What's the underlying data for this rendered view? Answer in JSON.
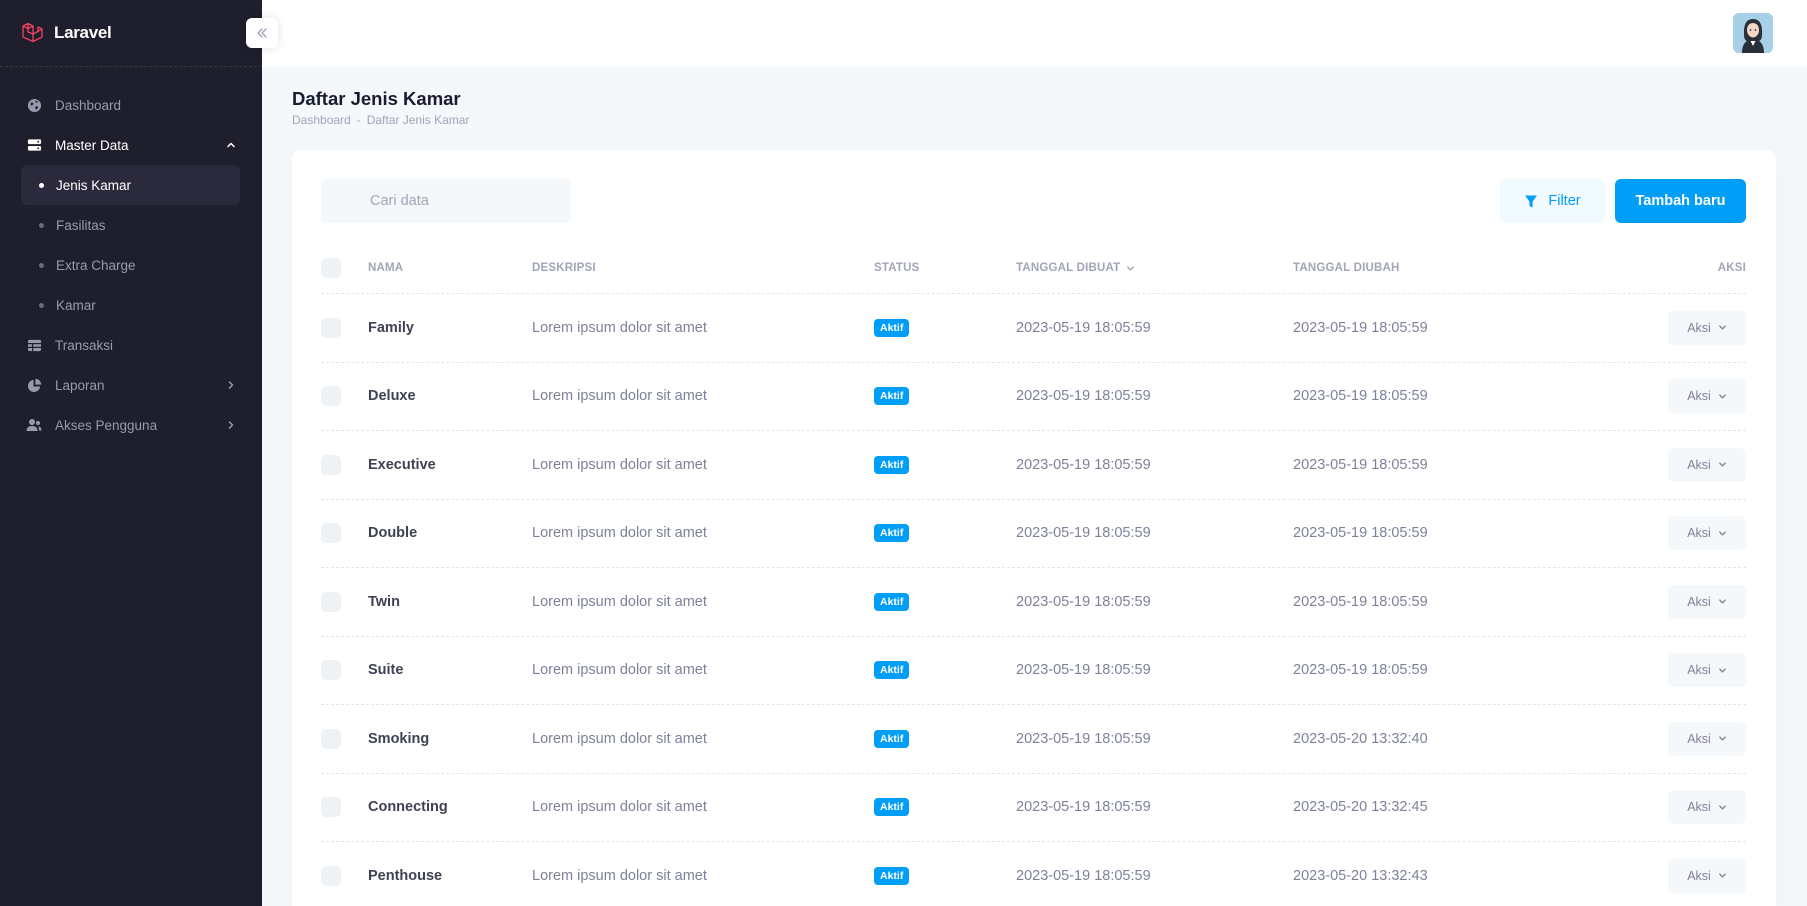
{
  "brand": {
    "name": "Laravel"
  },
  "colors": {
    "primary": "#009ef7",
    "sidebar": "#1e1e2d",
    "brand_red": "#f1425f"
  },
  "sidebar": {
    "items": [
      {
        "label": "Dashboard",
        "icon": "globe-icon"
      },
      {
        "label": "Master Data",
        "icon": "server-icon",
        "expanded": true,
        "children": [
          {
            "label": "Jenis Kamar",
            "active": true
          },
          {
            "label": "Fasilitas"
          },
          {
            "label": "Extra Charge"
          },
          {
            "label": "Kamar"
          }
        ]
      },
      {
        "label": "Transaksi",
        "icon": "table-icon"
      },
      {
        "label": "Laporan",
        "icon": "pie-chart-icon"
      },
      {
        "label": "Akses Pengguna",
        "icon": "users-icon"
      }
    ]
  },
  "page": {
    "title": "Daftar Jenis Kamar",
    "breadcrumb": [
      "Dashboard",
      "-",
      "Daftar Jenis Kamar"
    ]
  },
  "toolbar": {
    "search_placeholder": "Cari data",
    "filter_label": "Filter",
    "add_label": "Tambah baru"
  },
  "table": {
    "headers": {
      "nama": "Nama",
      "deskripsi": "Deskripsi",
      "status": "Status",
      "created": "Tanggal Dibuat",
      "updated": "Tanggal Diubah",
      "aksi": "Aksi"
    },
    "rows": [
      {
        "nama": "Family",
        "deskripsi": "Lorem ipsum dolor sit amet",
        "status": "Aktif",
        "created": "2023-05-19 18:05:59",
        "updated": "2023-05-19 18:05:59",
        "aksi": "Aksi"
      },
      {
        "nama": "Deluxe",
        "deskripsi": "Lorem ipsum dolor sit amet",
        "status": "Aktif",
        "created": "2023-05-19 18:05:59",
        "updated": "2023-05-19 18:05:59",
        "aksi": "Aksi"
      },
      {
        "nama": "Executive",
        "deskripsi": "Lorem ipsum dolor sit amet",
        "status": "Aktif",
        "created": "2023-05-19 18:05:59",
        "updated": "2023-05-19 18:05:59",
        "aksi": "Aksi"
      },
      {
        "nama": "Double",
        "deskripsi": "Lorem ipsum dolor sit amet",
        "status": "Aktif",
        "created": "2023-05-19 18:05:59",
        "updated": "2023-05-19 18:05:59",
        "aksi": "Aksi"
      },
      {
        "nama": "Twin",
        "deskripsi": "Lorem ipsum dolor sit amet",
        "status": "Aktif",
        "created": "2023-05-19 18:05:59",
        "updated": "2023-05-19 18:05:59",
        "aksi": "Aksi"
      },
      {
        "nama": "Suite",
        "deskripsi": "Lorem ipsum dolor sit amet",
        "status": "Aktif",
        "created": "2023-05-19 18:05:59",
        "updated": "2023-05-19 18:05:59",
        "aksi": "Aksi"
      },
      {
        "nama": "Smoking",
        "deskripsi": "Lorem ipsum dolor sit amet",
        "status": "Aktif",
        "created": "2023-05-19 18:05:59",
        "updated": "2023-05-20 13:32:40",
        "aksi": "Aksi"
      },
      {
        "nama": "Connecting",
        "deskripsi": "Lorem ipsum dolor sit amet",
        "status": "Aktif",
        "created": "2023-05-19 18:05:59",
        "updated": "2023-05-20 13:32:45",
        "aksi": "Aksi"
      },
      {
        "nama": "Penthouse",
        "deskripsi": "Lorem ipsum dolor sit amet",
        "status": "Aktif",
        "created": "2023-05-19 18:05:59",
        "updated": "2023-05-20 13:32:43",
        "aksi": "Aksi"
      }
    ]
  }
}
